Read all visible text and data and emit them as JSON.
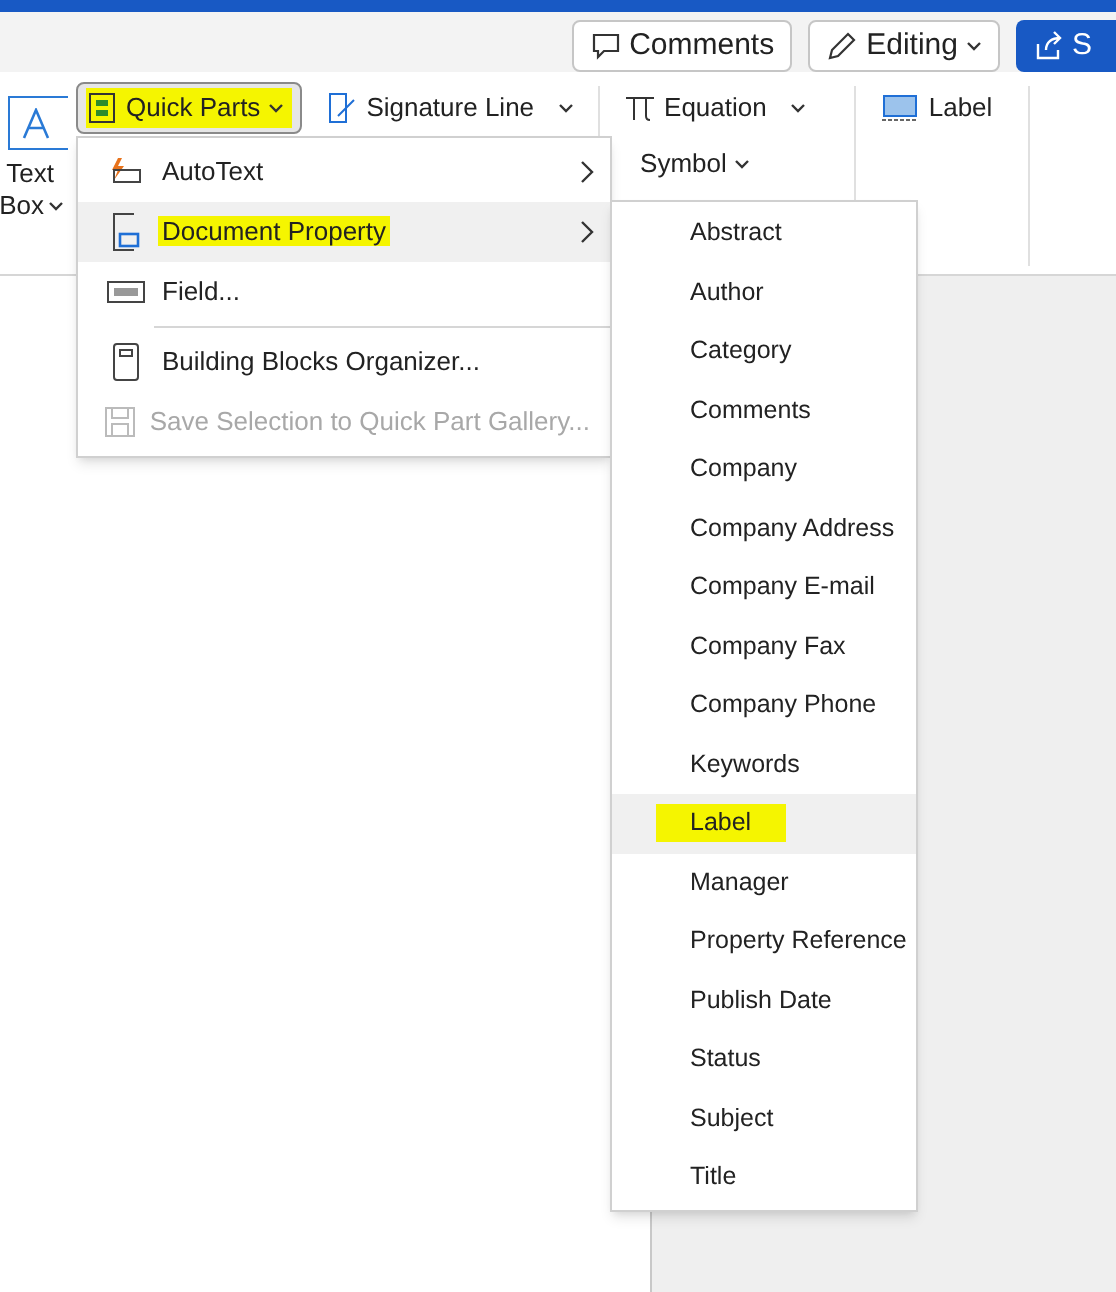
{
  "title_bar": {
    "buttons": [
      {
        "kind": "comments",
        "label": "Comments"
      },
      {
        "kind": "editing",
        "label": "Editing"
      },
      {
        "kind": "share",
        "label": "S"
      }
    ]
  },
  "ribbon": {
    "text_box": {
      "label_1": "Text",
      "label_2": "Box"
    },
    "quick_parts": {
      "label": "Quick Parts",
      "highlighted": true,
      "expanded": true
    },
    "signature_line": {
      "label": "Signature Line"
    },
    "equation": {
      "label": "Equation"
    },
    "symbol": {
      "label": "Symbol"
    },
    "label_button": {
      "label": "Label"
    }
  },
  "quick_parts_menu": [
    {
      "kind": "autotext",
      "label": "AutoText",
      "submenu": true,
      "selected": false,
      "highlighted": false,
      "disabled": false
    },
    {
      "kind": "docprop",
      "label": "Document Property",
      "submenu": true,
      "selected": true,
      "highlighted": true,
      "disabled": false
    },
    {
      "kind": "field",
      "label": "Field...",
      "submenu": false,
      "selected": false,
      "highlighted": false,
      "disabled": false
    },
    {
      "kind": "organizer",
      "label": "Building Blocks Organizer...",
      "submenu": false,
      "selected": false,
      "highlighted": false,
      "disabled": false
    },
    {
      "kind": "save",
      "label": "Save Selection to Quick Part Gallery...",
      "submenu": false,
      "selected": false,
      "highlighted": false,
      "disabled": true
    }
  ],
  "property_menu": [
    {
      "label": "Abstract",
      "selected": false,
      "highlighted": false
    },
    {
      "label": "Author",
      "selected": false,
      "highlighted": false
    },
    {
      "label": "Category",
      "selected": false,
      "highlighted": false
    },
    {
      "label": "Comments",
      "selected": false,
      "highlighted": false
    },
    {
      "label": "Company",
      "selected": false,
      "highlighted": false
    },
    {
      "label": "Company Address",
      "selected": false,
      "highlighted": false
    },
    {
      "label": "Company E-mail",
      "selected": false,
      "highlighted": false
    },
    {
      "label": "Company Fax",
      "selected": false,
      "highlighted": false
    },
    {
      "label": "Company Phone",
      "selected": false,
      "highlighted": false
    },
    {
      "label": "Keywords",
      "selected": false,
      "highlighted": false
    },
    {
      "label": "Label",
      "selected": true,
      "highlighted": true
    },
    {
      "label": "Manager",
      "selected": false,
      "highlighted": false
    },
    {
      "label": "Property Reference",
      "selected": false,
      "highlighted": false
    },
    {
      "label": "Publish Date",
      "selected": false,
      "highlighted": false
    },
    {
      "label": "Status",
      "selected": false,
      "highlighted": false
    },
    {
      "label": "Subject",
      "selected": false,
      "highlighted": false
    },
    {
      "label": "Title",
      "selected": false,
      "highlighted": false
    }
  ]
}
